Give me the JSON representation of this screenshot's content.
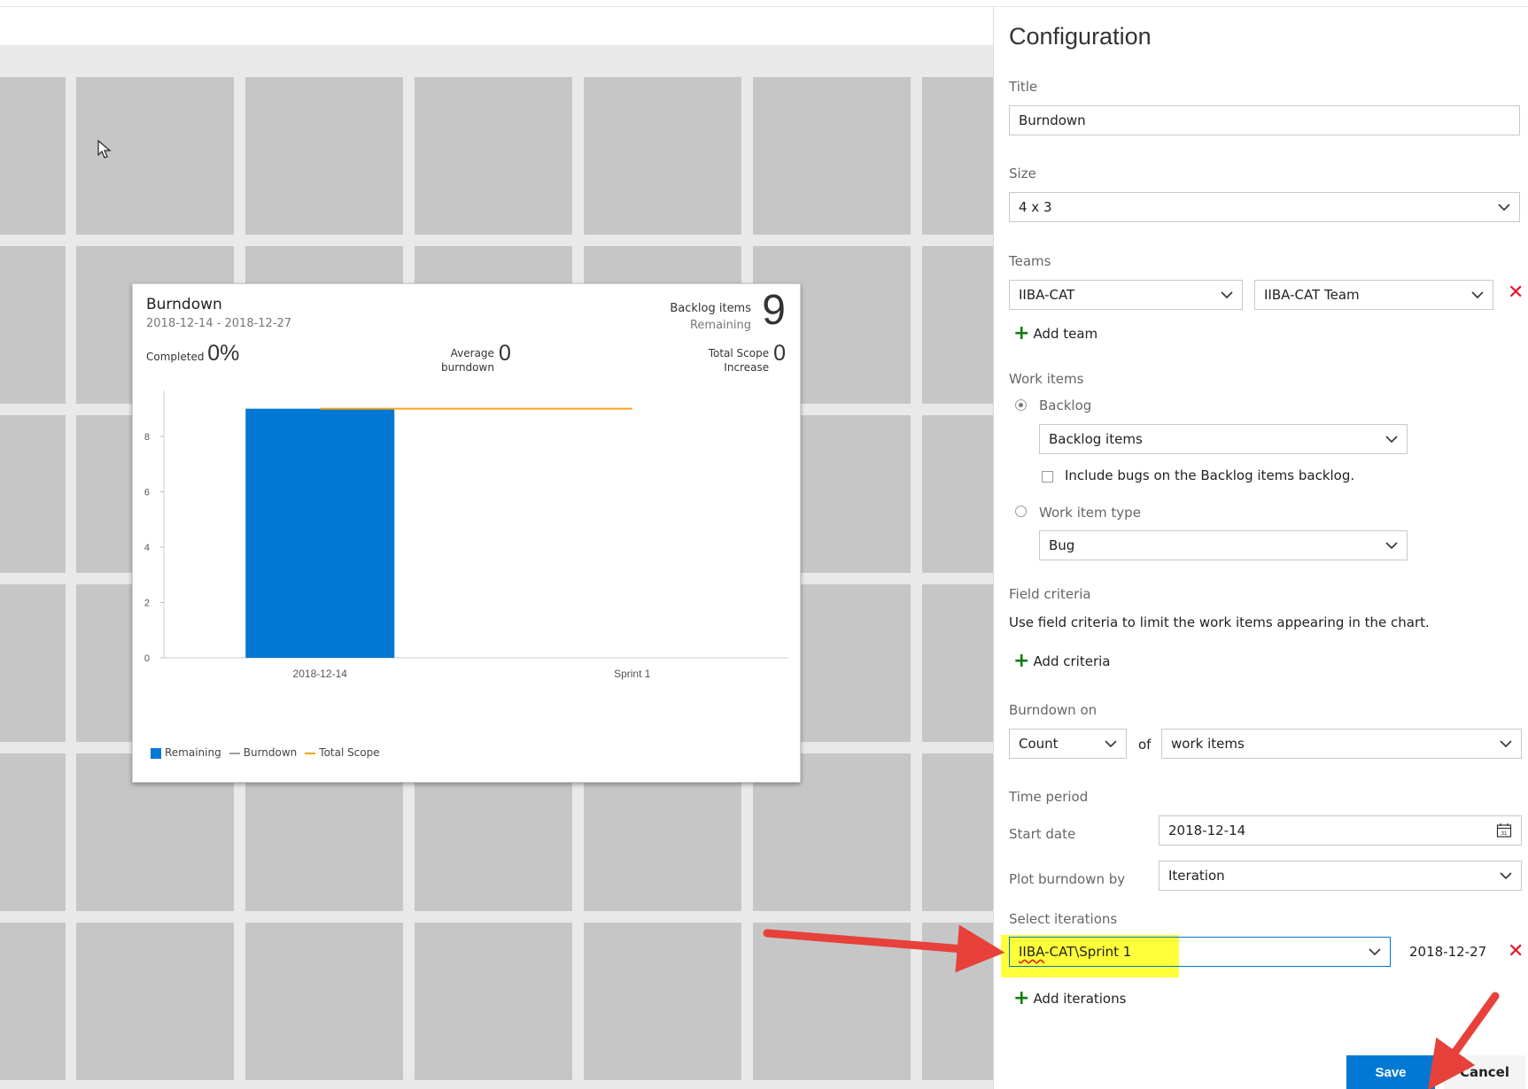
{
  "widget": {
    "title": "Burndown",
    "dates": "2018-12-14 - 2018-12-27",
    "backlog_label": "Backlog items",
    "remaining_label": "Remaining",
    "big_number": "9",
    "completed_label": "Completed",
    "completed_value": "0%",
    "avg_label_1": "Average",
    "avg_label_2": "burndown",
    "avg_value": "0",
    "scope_label_1": "Total Scope",
    "scope_label_2": "Increase",
    "scope_value": "0",
    "legend": {
      "remaining": "Remaining",
      "burndown": "Burndown",
      "total_scope": "Total Scope"
    },
    "colors": {
      "remaining": "#0078d4",
      "burndown": "#a0a0a0",
      "total_scope": "#f7a21d"
    }
  },
  "chart_data": {
    "type": "bar",
    "categories": [
      "2018-12-14",
      "Sprint 1"
    ],
    "series": [
      {
        "name": "Remaining",
        "values": [
          9,
          null
        ]
      },
      {
        "name": "Total Scope",
        "values": [
          9,
          9
        ]
      }
    ],
    "yticks": [
      "0",
      "2",
      "4",
      "6",
      "8"
    ],
    "ylim": [
      0,
      9.5
    ],
    "legend_position": "bottom-left"
  },
  "config": {
    "heading": "Configuration",
    "title_label": "Title",
    "title_value": "Burndown",
    "size_label": "Size",
    "size_value": "4 x 3",
    "teams_label": "Teams",
    "team_project": "IIBA-CAT",
    "team_name": "IIBA-CAT Team",
    "add_team": "Add team",
    "work_items_label": "Work items",
    "backlog_radio": "Backlog",
    "backlog_select": "Backlog items",
    "include_bugs": "Include bugs on the Backlog items backlog.",
    "work_item_type_radio": "Work item type",
    "work_item_type_select": "Bug",
    "field_criteria_label": "Field criteria",
    "field_criteria_desc": "Use field criteria to limit the work items appearing in the chart.",
    "add_criteria": "Add criteria",
    "burndown_on_label": "Burndown on",
    "burndown_count": "Count",
    "of_label": "of",
    "burndown_of": "work items",
    "time_period_label": "Time period",
    "start_date_label": "Start date",
    "start_date_value": "2018-12-14",
    "plot_by_label": "Plot burndown by",
    "plot_by_value": "Iteration",
    "select_iterations_label": "Select iterations",
    "iteration_prefix": "IIBA",
    "iteration_rest": "-CAT\\Sprint 1",
    "iteration_end_date": "2018-12-27",
    "add_iterations": "Add iterations",
    "save": "Save",
    "cancel": "Cancel"
  },
  "icons": {
    "chevron": "chevron-down-icon",
    "remove": "remove-icon",
    "calendar": "calendar-icon",
    "add": "plus-icon",
    "cursor": "mouse-cursor-icon"
  },
  "annotation_color": "#e8403a"
}
